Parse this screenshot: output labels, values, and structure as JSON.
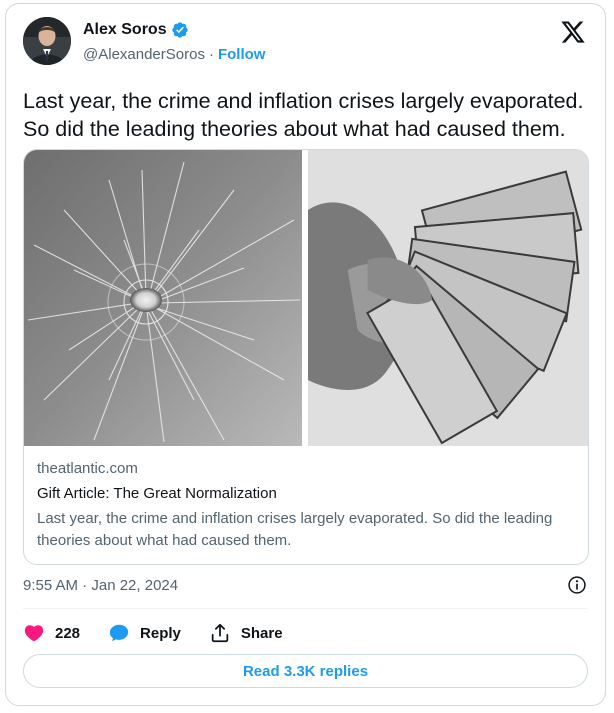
{
  "author": {
    "display_name": "Alex Soros",
    "handle": "@AlexanderSoros",
    "separator": "·",
    "follow_label": "Follow",
    "avatar_icon": "profile-photo",
    "verified_icon": "verified-badge-icon"
  },
  "tweet": {
    "text": "Last year, the crime and inflation crises largely evaporated. So did the leading theories about what had caused them."
  },
  "link_card": {
    "domain": "theatlantic.com",
    "title": "Gift Article: The Great Normalization",
    "description": "Last year, the crime and inflation crises largely evaporated. So did the leading theories about what had caused them.",
    "images": [
      "cracked-glass-photo",
      "cash-in-hand-photo"
    ]
  },
  "meta": {
    "timestamp": "9:55 AM · Jan 22, 2024"
  },
  "actions": {
    "likes_count": "228",
    "reply_label": "Reply",
    "share_label": "Share"
  },
  "footer": {
    "read_replies_label": "Read 3.3K replies"
  },
  "colors": {
    "accent": "#1d9bf0",
    "like": "#f91880",
    "text_secondary": "#536471",
    "border": "#cfd9de"
  }
}
